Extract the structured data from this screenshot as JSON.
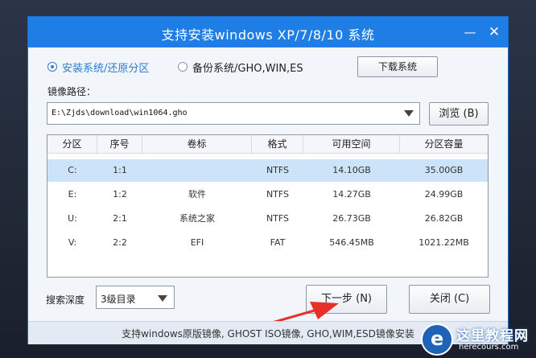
{
  "window": {
    "title": "支持安装windows XP/7/8/10 系统",
    "minimize_glyph": "—",
    "close_glyph": "✕"
  },
  "mode": {
    "install_label": "安装系统/还原分区",
    "backup_label": "备份系统/GHO,WIN,ES",
    "selected": "install"
  },
  "toolbar": {
    "download_label": "下载系统",
    "image_path_label": "镜像路径：",
    "image_path_value": "E:\\Zjds\\download\\win1064.gho",
    "browse_label": "浏览 (B)"
  },
  "partitions": {
    "headers": [
      "分区",
      "序号",
      "卷标",
      "格式",
      "可用空间",
      "分区容量"
    ],
    "rows": [
      [
        "C:",
        "1:1",
        "",
        "NTFS",
        "14.10GB",
        "35.00GB"
      ],
      [
        "E:",
        "1:2",
        "软件",
        "NTFS",
        "14.27GB",
        "24.99GB"
      ],
      [
        "U:",
        "2:1",
        "系统之家",
        "NTFS",
        "26.73GB",
        "26.82GB"
      ],
      [
        "V:",
        "2:2",
        "EFI",
        "FAT",
        "546.45MB",
        "1021.22MB"
      ]
    ],
    "selected_row": 0
  },
  "bottom": {
    "search_depth_label": "搜索深度",
    "search_depth_value": "3级目录",
    "next_label": "下一步 (N)",
    "close_label": "关闭 (C)"
  },
  "footer": {
    "text": "支持windows原版镜像, GHOST ISO镜像, GHO,WIM,ESD镜像安装"
  },
  "watermark": {
    "title": "这里教程网",
    "url": "herecours.com"
  },
  "colors": {
    "titlebar": "#1e7ee6",
    "selected_row": "#cde3f7",
    "accent": "#2b7bd3",
    "arrow": "#e8302a"
  }
}
